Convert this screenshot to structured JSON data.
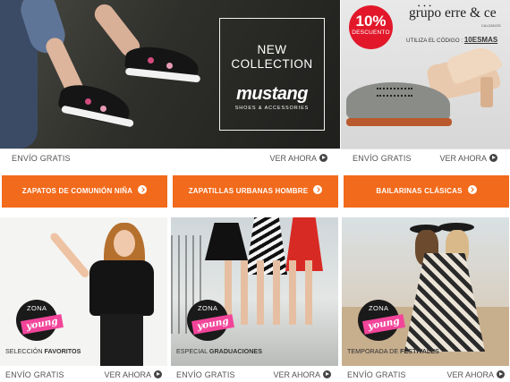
{
  "banners": {
    "mustang": {
      "heading": "NEW COLLECTION",
      "logo_text": "mustang",
      "logo_sub": "SHOES & ACCESSORIES",
      "shipping": "ENVÍO GRATIS",
      "cta": "VER AHORA"
    },
    "grupo": {
      "discount_pct": "10%",
      "discount_label": "DESCUENTO",
      "brand_text": "grupo  erre & ce",
      "brand_dots": "• • •",
      "brand_sub": "CALZADOS",
      "code_label": "UTILIZA EL CÓDIGO :",
      "code": "10ESMAS",
      "shipping": "ENVÍO GRATIS",
      "cta": "VER AHORA"
    }
  },
  "categories": [
    {
      "label": "ZAPATOS DE COMUNIÓN NIÑA"
    },
    {
      "label": "ZAPATILLAS URBANAS HOMBRE"
    },
    {
      "label": "BAILARINAS CLÁSICAS"
    }
  ],
  "zona": {
    "line1": "ZONA",
    "line2": "young"
  },
  "panels": [
    {
      "caption_plain": "SELECCIÓN ",
      "caption_bold": "FAVORITOS",
      "shipping": "ENVÍO GRATIS",
      "cta": "VER AHORA"
    },
    {
      "caption_plain": "ESPECIAL ",
      "caption_bold": "GRADUACIONES",
      "shipping": "ENVÍO GRATIS",
      "cta": "VER AHORA"
    },
    {
      "caption_plain": "TEMPORADA DE ",
      "caption_bold": "FESTIVALES",
      "shipping": "ENVÍO GRATIS",
      "cta": "VER AHORA"
    }
  ],
  "colors": {
    "accent": "#f26a1b",
    "discount_red": "#e2182a",
    "zona_pink": "#f2459a"
  },
  "icons": [
    "play-circle-icon",
    "chevron-right-circle-icon"
  ]
}
